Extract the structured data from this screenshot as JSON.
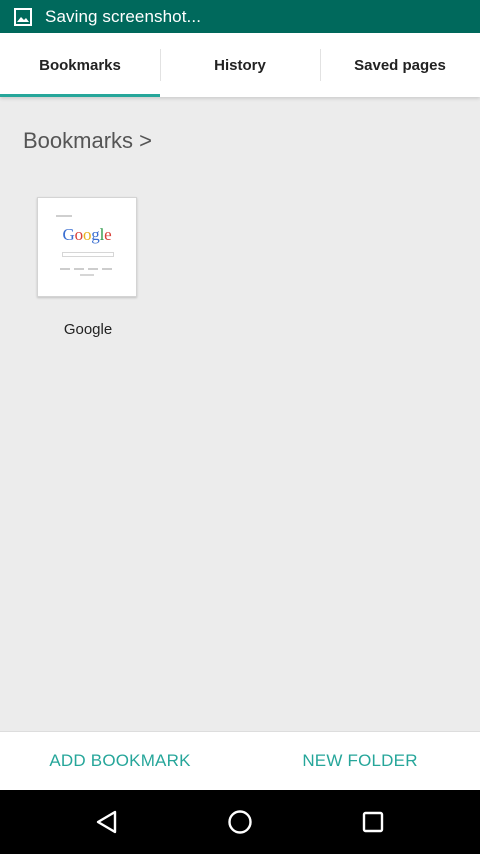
{
  "status_bar": {
    "text": "Saving screenshot...",
    "icon": "image-icon"
  },
  "tabs": [
    {
      "label": "Bookmarks",
      "active": true
    },
    {
      "label": "History",
      "active": false
    },
    {
      "label": "Saved pages",
      "active": false
    }
  ],
  "breadcrumb": "Bookmarks >",
  "bookmarks": [
    {
      "label": "Google",
      "thumbnail_logo": "Google"
    }
  ],
  "actions": {
    "add_bookmark": "ADD BOOKMARK",
    "new_folder": "NEW FOLDER"
  },
  "navigation": {
    "back_icon": "back-triangle-icon",
    "home_icon": "home-circle-icon",
    "recents_icon": "recents-square-icon"
  },
  "colors": {
    "status_bar": "#00695c",
    "accent": "#26a69a",
    "background": "#ececec"
  }
}
